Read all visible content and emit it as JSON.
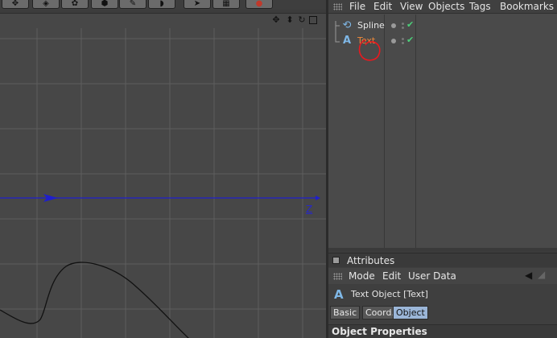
{
  "toolbar": {
    "icons": [
      "move-icon",
      "scene-icon",
      "render-icon",
      "cube-icon",
      "spline-tool-icon",
      "deformer-icon",
      "select-icon",
      "camera-icon",
      "record-icon"
    ]
  },
  "viewport": {
    "nav_icons": [
      "move-view-icon",
      "pan-view-icon",
      "rotate-view-icon",
      "maximize-view-icon"
    ],
    "axis_label": "Z"
  },
  "object_manager": {
    "menu": [
      "File",
      "Edit",
      "View",
      "Objects",
      "Tags",
      "Bookmarks"
    ],
    "objects": [
      {
        "name": "Spline",
        "icon": "spline-icon"
      },
      {
        "name": "Text",
        "icon": "text-icon"
      }
    ]
  },
  "attributes": {
    "title": "Attributes",
    "menu": [
      "Mode",
      "Edit",
      "User Data"
    ],
    "object_title": "Text Object [Text]",
    "object_icon_glyph": "A",
    "tabs": [
      "Basic",
      "Coord.",
      "Object"
    ],
    "active_tab": "Object",
    "section_title": "Object Properties"
  },
  "colors": {
    "axis_blue": "#1f1fcc",
    "highlight_red": "#e8191f",
    "active_tab": "#9bb6d8",
    "check_green": "#4dd07a"
  }
}
